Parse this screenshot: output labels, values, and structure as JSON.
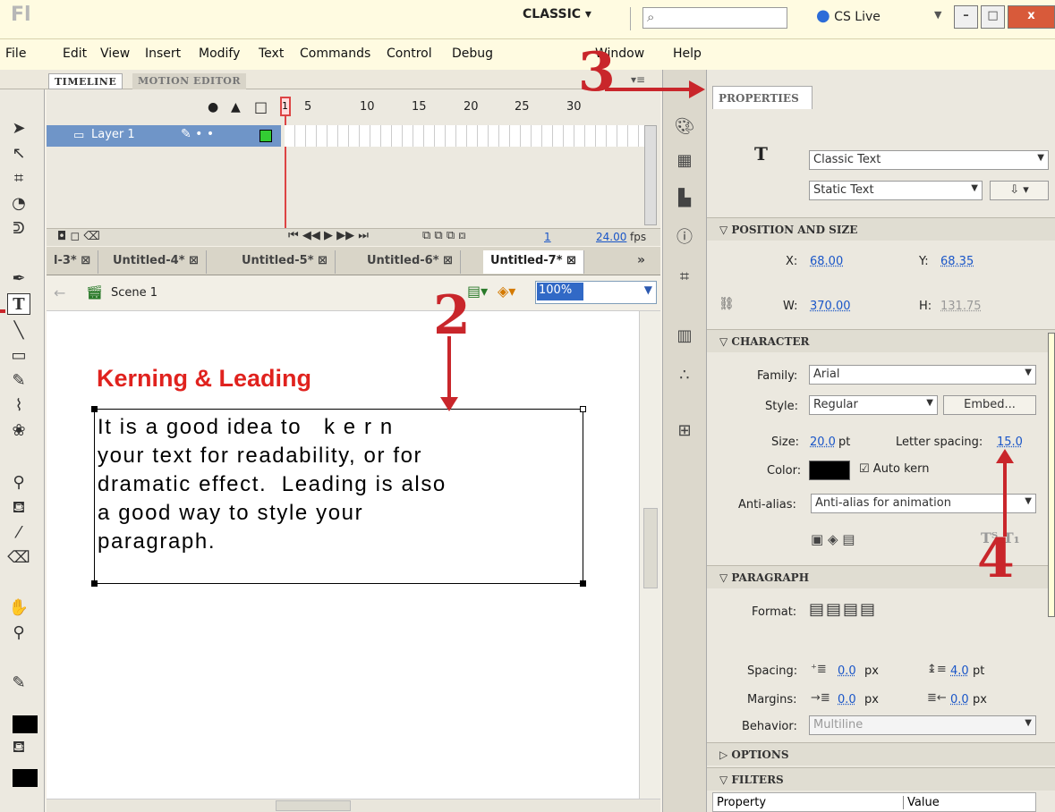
{
  "app": {
    "logo": "Fl",
    "workspace": "CLASSIC ▾",
    "search_icon": "⌕",
    "cslive_icon": "●",
    "cslive": "CS Live",
    "min": "–",
    "max": "□",
    "close": "x"
  },
  "menu": [
    "File",
    "Edit",
    "View",
    "Insert",
    "Modify",
    "Text",
    "Commands",
    "Control",
    "Debug",
    "Window",
    "Help"
  ],
  "timeline": {
    "tab1": "TIMELINE",
    "tab2": "MOTION EDITOR",
    "layer": "Layer 1",
    "ticks": [
      "1",
      "5",
      "10",
      "15",
      "20",
      "25",
      "30"
    ],
    "frame": "1",
    "fps": "24.00",
    "fps_unit": "fps"
  },
  "doctabs": [
    "l-3*",
    "Untitled-4*",
    "Untitled-5*",
    "Untitled-6*",
    "Untitled-7*"
  ],
  "doctab_more": "»",
  "scene": "Scene 1",
  "zoom": "100%",
  "stage": {
    "heading": "Kerning & Leading",
    "body": "It is a good idea to   k e r n\nyour text for readability, or for\ndramatic effect.  Leading is also\na good way to style your\nparagraph."
  },
  "props": {
    "tab": "PROPERTIES",
    "text_engine": "Classic Text",
    "text_type": "Static Text",
    "sec_position": "POSITION AND SIZE",
    "x_label": "X:",
    "x": "68.00",
    "y_label": "Y:",
    "y": "68.35",
    "w_label": "W:",
    "w": "370.00",
    "h_label": "H:",
    "h": "131.75",
    "sec_character": "CHARACTER",
    "family_label": "Family:",
    "family": "Arial",
    "style_label": "Style:",
    "style": "Regular",
    "embed": "Embed...",
    "size_label": "Size:",
    "size": "20.0",
    "size_unit": "pt",
    "ls_label": "Letter spacing:",
    "ls": "15.0",
    "color_label": "Color:",
    "autokern": "Auto kern",
    "aa_label": "Anti-alias:",
    "aa": "Anti-alias for animation",
    "sec_paragraph": "PARAGRAPH",
    "format_label": "Format:",
    "spacing_label": "Spacing:",
    "indent": "0.0",
    "indent_unit": "px",
    "linesp": "4.0",
    "linesp_unit": "pt",
    "margins_label": "Margins:",
    "ml": "0.0",
    "ml_unit": "px",
    "mr": "0.0",
    "mr_unit": "px",
    "behavior_label": "Behavior:",
    "behavior": "Multiline",
    "sec_options": "OPTIONS",
    "sec_filters": "FILTERS",
    "col_property": "Property",
    "col_value": "Value"
  },
  "annotations": [
    "2",
    "3",
    "4"
  ],
  "colors": {
    "accent_red": "#c9262b",
    "heading_red": "#e0221e",
    "link_blue": "#1a56c8",
    "text_color": "#000000"
  }
}
